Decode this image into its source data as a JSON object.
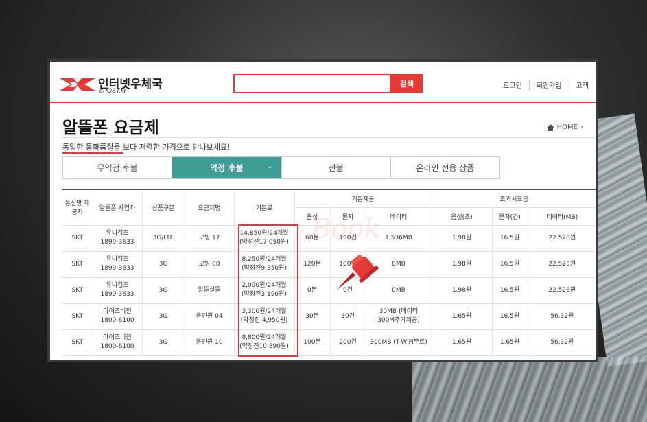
{
  "header": {
    "logo_text": "인터넷우체국",
    "logo_sub": "ePOST.kr",
    "search_button": "검색",
    "links": [
      "로그인",
      "회원가입",
      "고객"
    ]
  },
  "page": {
    "title": "알뜰폰 요금제",
    "breadcrumb": "HOME",
    "subtitle": "동일한 통화품질을 보다 저렴한 가격으로 만나보세요!"
  },
  "tabs": [
    {
      "label": "무약정 후불"
    },
    {
      "label": "약정 후불"
    },
    {
      "label": "선불"
    },
    {
      "label": "온라인 전용 상품"
    }
  ],
  "table": {
    "headers": {
      "carrier": "통신망 제공자",
      "provider": "알뜰폰 사업자",
      "type": "상품구분",
      "plan": "요금제명",
      "base_fee": "기본료",
      "basic_group": "기본제공",
      "voice": "음성",
      "sms": "문자",
      "data": "데이터",
      "over_group": "초과시요금",
      "over_voice": "음성(초)",
      "over_sms": "문자(건)",
      "over_data": "데이터(MB)"
    },
    "rows": [
      {
        "carrier": "SKT",
        "provider": "유니컴즈",
        "phone": "1899-3633",
        "type": "3G/LTE",
        "plan": "모빙 17",
        "fee": "14,850원/24개월",
        "fee_note": "(약정전17,050원)",
        "voice": "60분",
        "sms": "100건",
        "data": "1,536MB",
        "data2": "",
        "over_voice": "1.98원",
        "over_sms": "16.5원",
        "over_data": "22.528원"
      },
      {
        "carrier": "SKT",
        "provider": "유니컴즈",
        "phone": "1899-3633",
        "type": "3G",
        "plan": "모빙 08",
        "fee": "8,250원/24개월",
        "fee_note": "(약정전9,350원)",
        "voice": "120분",
        "sms": "100건",
        "data": "0MB",
        "data2": "",
        "over_voice": "1.98원",
        "over_sms": "16.5원",
        "over_data": "22.528원"
      },
      {
        "carrier": "SKT",
        "provider": "유니컴즈",
        "phone": "1899-3633",
        "type": "3G",
        "plan": "알뜰살뜰",
        "fee": "2,090원/24개월",
        "fee_note": "(약정전3,190원)",
        "voice": "0분",
        "sms": "0건",
        "data": "0MB",
        "data2": "",
        "over_voice": "1.98원",
        "over_sms": "16.5원",
        "over_data": "22.528원"
      },
      {
        "carrier": "SKT",
        "provider": "아이즈비전",
        "phone": "1800-6100",
        "type": "3G",
        "plan": "윤인원 04",
        "fee": "3,300원/24개월",
        "fee_note": "(약정전 4,950원)",
        "voice": "30분",
        "sms": "30건",
        "data": "30MB (데이터",
        "data2": "300M추가제공)",
        "over_voice": "1.65원",
        "over_sms": "16.5원",
        "over_data": "56.32원"
      },
      {
        "carrier": "SKT",
        "provider": "아이즈비전",
        "phone": "1800-6100",
        "type": "3G",
        "plan": "윤인원 10",
        "fee": "8,800원/24개월",
        "fee_note": "(약정전10,890원)",
        "voice": "100분",
        "sms": "200건",
        "data": "300MB (T-WiFi무료)",
        "data2": "",
        "over_voice": "1.65원",
        "over_sms": "1.65원",
        "over_data": "56.32원"
      }
    ]
  },
  "watermark": "Book",
  "colors": {
    "accent": "#e53935",
    "tab_active": "#3e9e95"
  },
  "icons": {
    "pin": "push-pin-icon",
    "home": "home-icon"
  }
}
